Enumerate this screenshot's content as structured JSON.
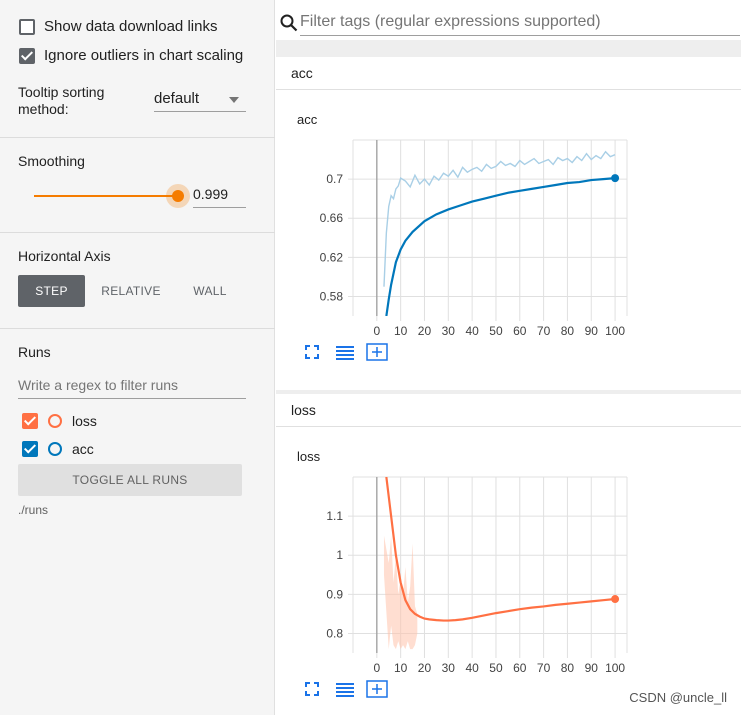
{
  "sidebar": {
    "show_download_links": "Show data download links",
    "ignore_outliers": "Ignore outliers in chart scaling",
    "tooltip_label_line1": "Tooltip sorting",
    "tooltip_label_line2": "method:",
    "tooltip_value": "default",
    "smoothing_label": "Smoothing",
    "smoothing_value": "0.999",
    "smoothing_fraction": 0.999,
    "horizontal_axis_label": "Horizontal Axis",
    "axis_options": [
      "STEP",
      "RELATIVE",
      "WALL"
    ],
    "axis_selected": "STEP",
    "runs_label": "Runs",
    "runs_filter_placeholder": "Write a regex to filter runs",
    "runs": [
      {
        "name": "loss",
        "checked": true,
        "color": "#ff7043"
      },
      {
        "name": "acc",
        "checked": true,
        "color": "#0077bb"
      }
    ],
    "toggle_all_label": "TOGGLE ALL RUNS",
    "runs_dir": "./runs"
  },
  "search": {
    "placeholder": "Filter tags (regular expressions supported)"
  },
  "cards": [
    {
      "header": "acc",
      "title": "acc"
    },
    {
      "header": "loss",
      "title": "loss"
    }
  ],
  "watermark": "CSDN @uncle_ll",
  "chart_data": [
    {
      "type": "line",
      "title": "acc",
      "xlim": [
        -10,
        105
      ],
      "ylim": [
        0.56,
        0.74
      ],
      "x_ticks": [
        0,
        10,
        20,
        30,
        40,
        50,
        60,
        70,
        80,
        90,
        100
      ],
      "y_ticks": [
        0.58,
        0.62,
        0.66,
        0.7
      ],
      "y_tick_labels": [
        "0.58",
        "0.62",
        "0.66",
        "0.7"
      ],
      "grid": true,
      "series": [
        {
          "color": "#0077bb",
          "style": "smoothed",
          "x": [
            4,
            5,
            6,
            8,
            10,
            12,
            15,
            20,
            25,
            30,
            35,
            40,
            45,
            50,
            55,
            60,
            65,
            70,
            75,
            80,
            85,
            90,
            95,
            100
          ],
          "y": [
            0.56,
            0.577,
            0.592,
            0.615,
            0.628,
            0.637,
            0.646,
            0.657,
            0.664,
            0.669,
            0.673,
            0.677,
            0.68,
            0.683,
            0.686,
            0.688,
            0.69,
            0.692,
            0.694,
            0.696,
            0.697,
            0.699,
            0.7,
            0.701
          ]
        },
        {
          "color": "#a9cfe6",
          "style": "raw",
          "x": [
            3,
            4,
            5,
            6,
            7,
            8,
            9,
            10,
            12,
            14,
            16,
            18,
            20,
            22,
            24,
            26,
            28,
            30,
            32,
            34,
            36,
            38,
            40,
            42,
            44,
            46,
            48,
            50,
            52,
            54,
            56,
            58,
            60,
            62,
            64,
            66,
            68,
            70,
            72,
            74,
            76,
            78,
            80,
            82,
            84,
            86,
            88,
            90,
            92,
            94,
            96,
            98,
            100
          ],
          "y": [
            0.59,
            0.645,
            0.672,
            0.683,
            0.68,
            0.69,
            0.693,
            0.701,
            0.698,
            0.692,
            0.704,
            0.695,
            0.7,
            0.694,
            0.703,
            0.699,
            0.706,
            0.703,
            0.709,
            0.702,
            0.712,
            0.707,
            0.71,
            0.712,
            0.708,
            0.715,
            0.711,
            0.713,
            0.718,
            0.714,
            0.716,
            0.713,
            0.719,
            0.715,
            0.718,
            0.721,
            0.716,
            0.718,
            0.72,
            0.715,
            0.722,
            0.719,
            0.721,
            0.717,
            0.723,
            0.719,
            0.726,
            0.72,
            0.724,
            0.721,
            0.728,
            0.723,
            0.725
          ]
        }
      ]
    },
    {
      "type": "line",
      "title": "loss",
      "xlim": [
        -10,
        105
      ],
      "ylim": [
        0.75,
        1.2
      ],
      "x_ticks": [
        0,
        10,
        20,
        30,
        40,
        50,
        60,
        70,
        80,
        90,
        100
      ],
      "y_ticks": [
        0.8,
        0.9,
        1,
        1.1
      ],
      "y_tick_labels": [
        "0.8",
        "0.9",
        "1",
        "1.1"
      ],
      "grid": true,
      "series": [
        {
          "color": "#ff7043",
          "style": "smoothed",
          "x": [
            4,
            6,
            8,
            10,
            12,
            14,
            16,
            18,
            20,
            22,
            25,
            28,
            30,
            33,
            36,
            40,
            45,
            50,
            55,
            60,
            65,
            70,
            75,
            80,
            85,
            90,
            95,
            100
          ],
          "y": [
            1.2,
            1.1,
            1.0,
            0.93,
            0.885,
            0.862,
            0.85,
            0.843,
            0.838,
            0.836,
            0.834,
            0.833,
            0.833,
            0.834,
            0.836,
            0.84,
            0.846,
            0.852,
            0.857,
            0.862,
            0.866,
            0.869,
            0.873,
            0.876,
            0.879,
            0.882,
            0.885,
            0.888
          ]
        },
        {
          "color": "#ffc2ab",
          "style": "raw-band",
          "x": [
            3,
            5,
            6,
            7,
            8,
            9,
            10,
            11,
            12,
            13,
            14,
            15,
            16,
            17
          ],
          "upper": [
            1.05,
            0.98,
            1.05,
            0.93,
            1.0,
            0.9,
            0.94,
            0.9,
            0.97,
            0.88,
            0.92,
            1.03,
            0.87,
            0.85
          ],
          "lower": [
            0.95,
            0.76,
            0.82,
            0.77,
            0.76,
            0.78,
            0.76,
            0.77,
            0.76,
            0.78,
            0.76,
            0.76,
            0.77,
            0.8
          ]
        }
      ]
    }
  ]
}
